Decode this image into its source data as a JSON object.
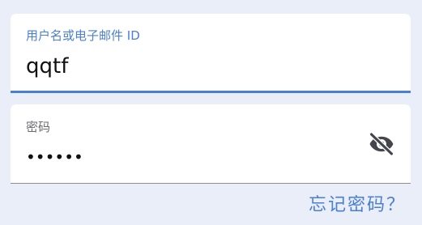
{
  "username_field": {
    "label": "用户名或电子邮件 ID",
    "value": "qqtf"
  },
  "password_field": {
    "label": "密码",
    "value": "••••••",
    "visibility_icon": "eye-off-icon"
  },
  "forgot_password": {
    "label": "忘记密码？"
  },
  "colors": {
    "accent": "#4a7fd6",
    "background": "#e9eef9",
    "field_background": "#ffffff",
    "label_gray": "#6b6b70",
    "icon_gray": "#44464c"
  }
}
